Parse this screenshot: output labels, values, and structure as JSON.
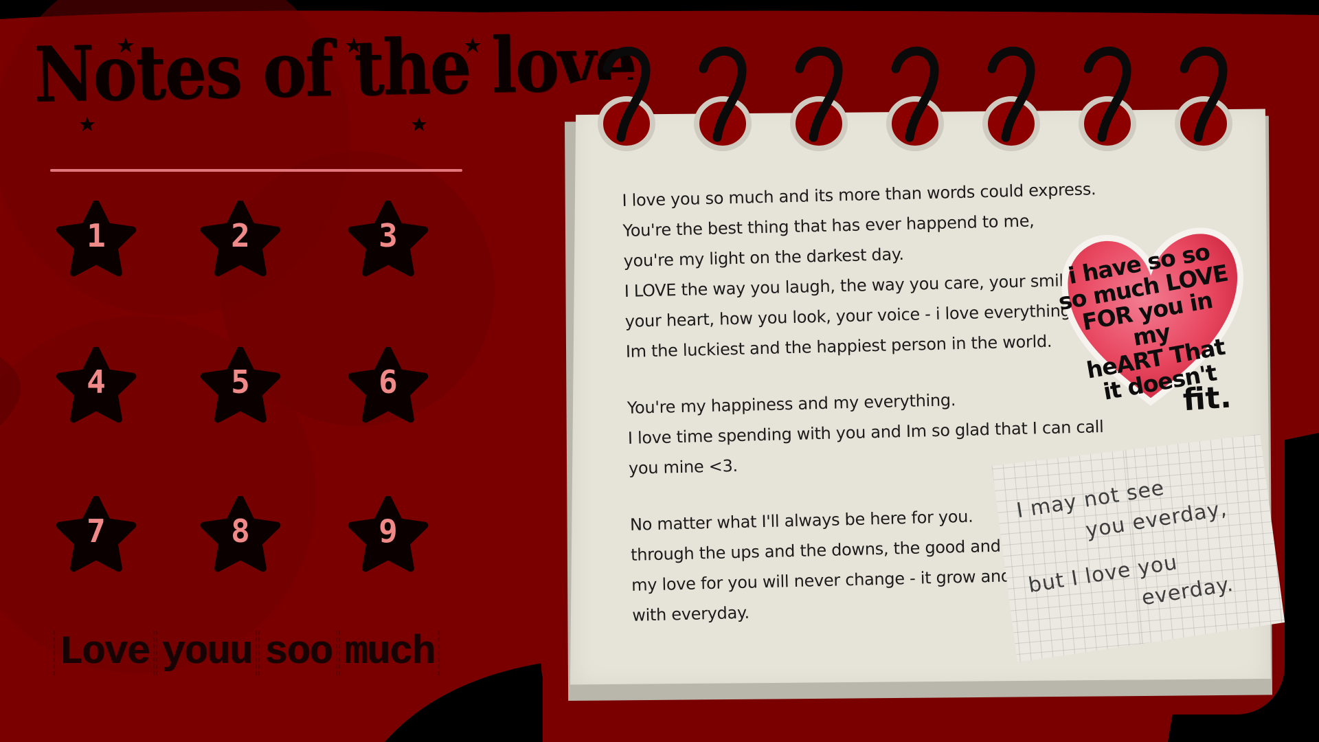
{
  "title": "Notes of the love",
  "menu": {
    "items": [
      {
        "label": "1"
      },
      {
        "label": "2"
      },
      {
        "label": "3"
      },
      {
        "label": "4"
      },
      {
        "label": "5"
      },
      {
        "label": "6"
      },
      {
        "label": "7"
      },
      {
        "label": "8"
      },
      {
        "label": "9"
      }
    ]
  },
  "footer": {
    "words": [
      "Love",
      "youu",
      "soo",
      "much"
    ]
  },
  "note": {
    "lines": [
      "I love you so much and its more than words could express.",
      "You're the best thing that has ever happend to me,",
      "you're my light on the darkest day.",
      "I LOVE the way you laugh, the way you care, your smile,",
      "your heart, how you look, your voice - i love everything in you.",
      "Im the luckiest and the happiest person in the world.",
      "",
      "You're my happiness and my everything.",
      "I love time spending with you and Im so glad that I can call",
      "you mine <3.",
      "",
      "No matter what I'll always be here for you.",
      "through the ups and the downs, the good and the bads,",
      "my love for you will never change - it grow and grow",
      "with everyday."
    ]
  },
  "heart_sticker": {
    "lines": [
      "i have so so",
      "so much LOVE",
      "FOR you in my",
      "heART That",
      "it doesn't"
    ],
    "last_word": "fit."
  },
  "grid_note": {
    "lines": [
      "I may not see",
      "you everday,",
      "",
      "but I love you",
      "everday."
    ]
  },
  "colors": {
    "background": "#7a0000",
    "accent": "#e2767a",
    "star": "#0a0000",
    "star_number": "#f08a88",
    "paper": "#e6e3d8"
  },
  "icons": {
    "menu_item": "star-icon",
    "binding": "spiral-ring-icon",
    "sticker": "heart-icon"
  }
}
